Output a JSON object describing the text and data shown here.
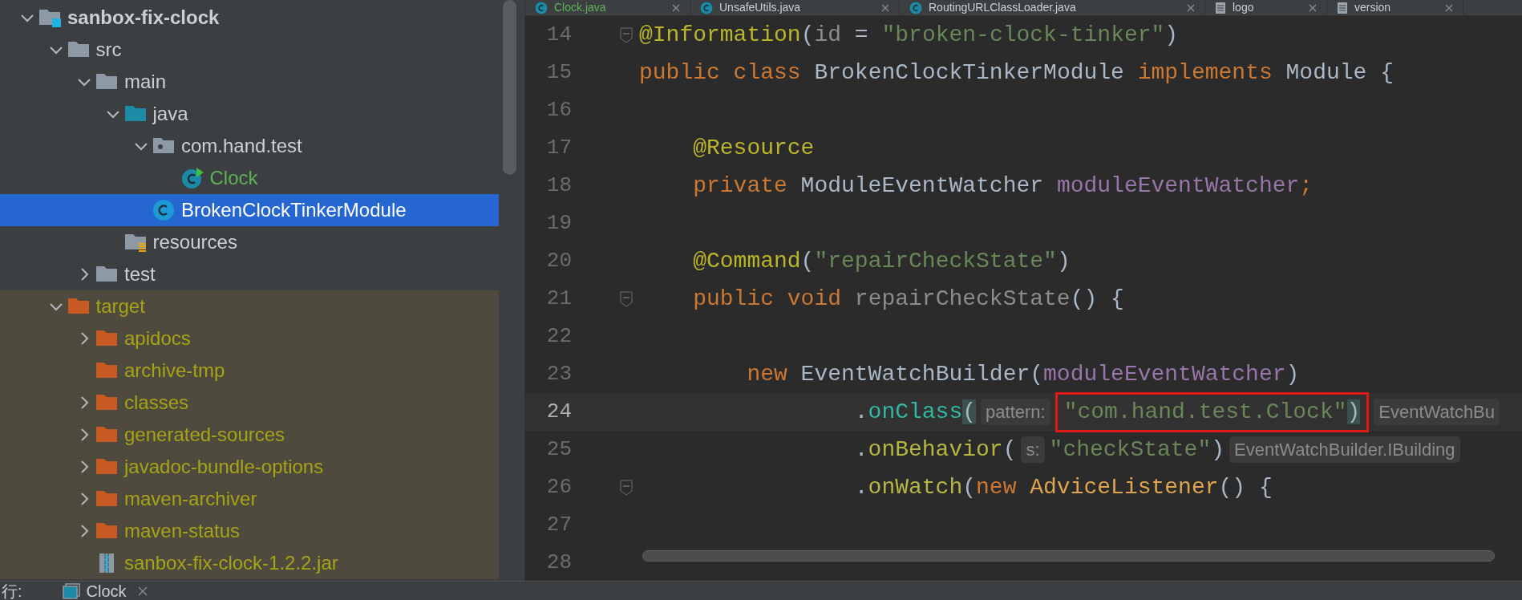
{
  "project_tree": [
    {
      "label": "sanbox-fix-clock",
      "kind": "project",
      "expanded": true,
      "selected": false,
      "excluded": false,
      "children": [
        {
          "label": "src",
          "kind": "folder",
          "expanded": true,
          "selected": false,
          "excluded": false,
          "children": [
            {
              "label": "main",
              "kind": "folder",
              "expanded": true,
              "selected": false,
              "excluded": false,
              "children": [
                {
                  "label": "java",
                  "kind": "source-folder",
                  "expanded": true,
                  "selected": false,
                  "excluded": false,
                  "children": [
                    {
                      "label": "com.hand.test",
                      "kind": "package",
                      "expanded": true,
                      "selected": false,
                      "excluded": false,
                      "children": [
                        {
                          "label": "Clock",
                          "kind": "runnable-class",
                          "selected": false,
                          "excluded": false,
                          "added": true
                        }
                      ]
                    },
                    {
                      "label": "BrokenClockTinkerModule",
                      "kind": "class",
                      "selected": true,
                      "excluded": false
                    }
                  ]
                },
                {
                  "label": "resources",
                  "kind": "resource-folder",
                  "selected": false,
                  "excluded": false
                }
              ]
            },
            {
              "label": "test",
              "kind": "folder",
              "expanded": false,
              "selected": false,
              "excluded": false
            }
          ]
        },
        {
          "label": "target",
          "kind": "folder",
          "expanded": true,
          "selected": false,
          "excluded": true,
          "children": [
            {
              "label": "apidocs",
              "kind": "folder",
              "expanded": false,
              "selected": false,
              "excluded": true
            },
            {
              "label": "archive-tmp",
              "kind": "folder",
              "selected": false,
              "excluded": true
            },
            {
              "label": "classes",
              "kind": "folder",
              "expanded": false,
              "selected": false,
              "excluded": true
            },
            {
              "label": "generated-sources",
              "kind": "folder",
              "expanded": false,
              "selected": false,
              "excluded": true
            },
            {
              "label": "javadoc-bundle-options",
              "kind": "folder",
              "expanded": false,
              "selected": false,
              "excluded": true
            },
            {
              "label": "maven-archiver",
              "kind": "folder",
              "expanded": false,
              "selected": false,
              "excluded": true
            },
            {
              "label": "maven-status",
              "kind": "folder",
              "expanded": false,
              "selected": false,
              "excluded": true
            },
            {
              "label": "sanbox-fix-clock-1.2.2.jar",
              "kind": "jar",
              "selected": false,
              "excluded": true
            }
          ]
        }
      ]
    }
  ],
  "editor_tabs": [
    {
      "label": "Clock.java",
      "kind": "class",
      "added": true
    },
    {
      "label": "UnsafeUtils.java",
      "kind": "class"
    },
    {
      "label": "RoutingURLClassLoader.java",
      "kind": "class"
    },
    {
      "label": "logo",
      "kind": "file"
    },
    {
      "label": "version",
      "kind": "file"
    }
  ],
  "code_lines": [
    {
      "number": "14",
      "fold": true,
      "current": false,
      "tokens": [
        {
          "text": "@Information",
          "kind": "ann"
        },
        {
          "text": "(",
          "kind": "plain"
        },
        {
          "text": "id",
          "kind": "param"
        },
        {
          "text": " = ",
          "kind": "plain"
        },
        {
          "text": "\"broken-clock-tinker\"",
          "kind": "str"
        },
        {
          "text": ")",
          "kind": "plain"
        }
      ]
    },
    {
      "number": "15",
      "fold": false,
      "current": false,
      "tokens": [
        {
          "text": "public class ",
          "kind": "kw"
        },
        {
          "text": "BrokenClockTinkerModule ",
          "kind": "plain"
        },
        {
          "text": "implements ",
          "kind": "kw"
        },
        {
          "text": "Module {",
          "kind": "plain"
        }
      ],
      "children": [
        {
          "number": "16",
          "fold": false,
          "current": false
        },
        {
          "number": "17",
          "fold": false,
          "current": false,
          "tokens": [
            {
              "text": "@Resource",
              "kind": "ann"
            }
          ]
        },
        {
          "number": "18",
          "fold": false,
          "current": false,
          "tokens": [
            {
              "text": "private ",
              "kind": "kw"
            },
            {
              "text": "ModuleEventWatcher ",
              "kind": "plain"
            },
            {
              "text": "moduleEventWatcher",
              "kind": "field"
            },
            {
              "text": ";",
              "kind": "kw"
            }
          ]
        },
        {
          "number": "19",
          "fold": false,
          "current": false
        },
        {
          "number": "20",
          "fold": false,
          "current": false,
          "tokens": [
            {
              "text": "@Command",
              "kind": "ann"
            },
            {
              "text": "(",
              "kind": "plain"
            },
            {
              "text": "\"repairCheckState\"",
              "kind": "str"
            },
            {
              "text": ")",
              "kind": "plain"
            }
          ]
        },
        {
          "number": "21",
          "fold": true,
          "current": false,
          "tokens": [
            {
              "text": "public void ",
              "kind": "kw"
            },
            {
              "text": "repairCheckState",
              "kind": "unused"
            },
            {
              "text": "() {",
              "kind": "plain"
            }
          ],
          "children": [
            {
              "number": "22",
              "fold": false,
              "current": false
            },
            {
              "number": "23",
              "fold": false,
              "current": false,
              "tokens": [
                {
                  "text": "new ",
                  "kind": "kw"
                },
                {
                  "text": "EventWatchBuilder(",
                  "kind": "plain"
                },
                {
                  "text": "moduleEventWatcher",
                  "kind": "field"
                },
                {
                  "text": ")",
                  "kind": "plain"
                }
              ],
              "children": [
                {
                  "number": "24",
                  "fold": false,
                  "current": true,
                  "continuation": true,
                  "tokens": [
                    {
                      "text": ".",
                      "kind": "plain"
                    },
                    {
                      "text": "onClass",
                      "kind": "call"
                    },
                    {
                      "text": "(",
                      "kind": "match"
                    },
                    {
                      "text": "pattern:",
                      "kind": "hint"
                    },
                    {
                      "text": "\"com.hand.test.Clock\"",
                      "kind": "str",
                      "boxed": true
                    },
                    {
                      "text": ")",
                      "kind": "match",
                      "boxed": true
                    },
                    {
                      "text": "EventWatchBu",
                      "kind": "hint"
                    }
                  ]
                },
                {
                  "number": "25",
                  "fold": false,
                  "current": false,
                  "continuation": true,
                  "tokens": [
                    {
                      "text": ".",
                      "kind": "plain"
                    },
                    {
                      "text": "onBehavior",
                      "kind": "call2"
                    },
                    {
                      "text": "(",
                      "kind": "plain"
                    },
                    {
                      "text": "s:",
                      "kind": "hint"
                    },
                    {
                      "text": "\"checkState\"",
                      "kind": "str"
                    },
                    {
                      "text": ")",
                      "kind": "plain"
                    },
                    {
                      "text": "EventWatchBuilder.IBuilding",
                      "kind": "hint"
                    }
                  ]
                },
                {
                  "number": "26",
                  "fold": true,
                  "current": false,
                  "continuation": true,
                  "tokens": [
                    {
                      "text": ".",
                      "kind": "plain"
                    },
                    {
                      "text": "onWatch",
                      "kind": "call2"
                    },
                    {
                      "text": "(",
                      "kind": "plain"
                    },
                    {
                      "text": "new ",
                      "kind": "kw"
                    },
                    {
                      "text": "AdviceListener",
                      "kind": "type2"
                    },
                    {
                      "text": "() {",
                      "kind": "plain"
                    }
                  ],
                  "children": [
                    {
                      "number": "27",
                      "fold": false,
                      "current": false
                    },
                    {
                      "number": "28",
                      "fold": false,
                      "current": false
                    }
                  ]
                }
              ]
            }
          ]
        }
      ]
    }
  ],
  "run_bar": {
    "label": "行:",
    "tabs": [
      {
        "label": "Clock"
      }
    ]
  }
}
